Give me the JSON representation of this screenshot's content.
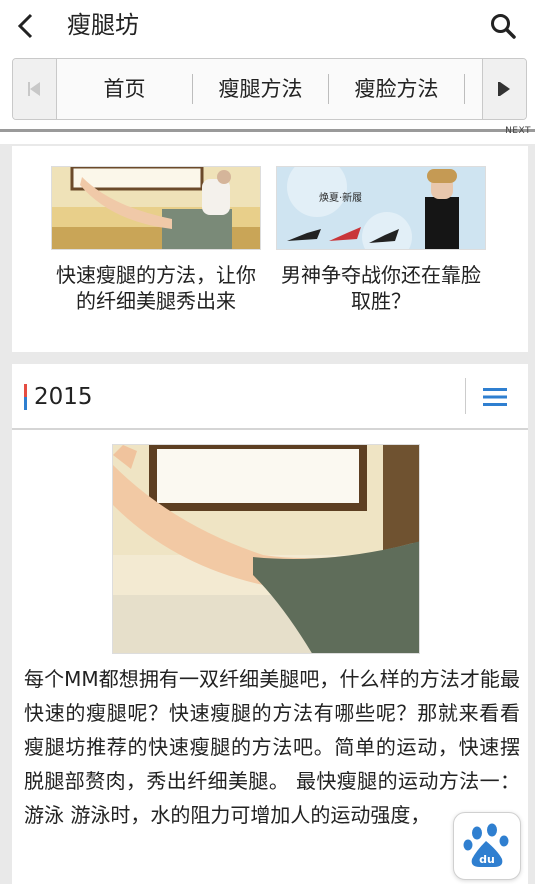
{
  "header": {
    "title": "瘦腿坊"
  },
  "nav": {
    "items": [
      "首页",
      "瘦腿方法",
      "瘦脸方法"
    ],
    "next_label": "NEXT"
  },
  "featured": [
    {
      "caption": "快速瘦腿的方法，让你的纤细美腿秀出来"
    },
    {
      "caption": "男神争夺战你还在靠脸取胜？",
      "banner_text": "焕夏·新履"
    }
  ],
  "section": {
    "title": "2015"
  },
  "article": {
    "body": "每个MM都想拥有一双纤细美腿吧，什么样的方法才能最快速的瘦腿呢？快速瘦腿的方法有哪些呢？那就来看看瘦腿坊推荐的快速瘦腿的方法吧。简单的运动，快速摆脱腿部赘肉，秀出纤细美腿。 最快瘦腿的运动方法一：游泳 游泳时，水的阻力可增加人的运动强度，"
  },
  "icons": {
    "back": "chevron-left-icon",
    "search": "search-icon",
    "menu": "hamburger-menu-icon",
    "baidu": "baidu-paw-icon"
  },
  "colors": {
    "accent_blue": "#2f7fd0",
    "accent_red": "#e54d42"
  }
}
